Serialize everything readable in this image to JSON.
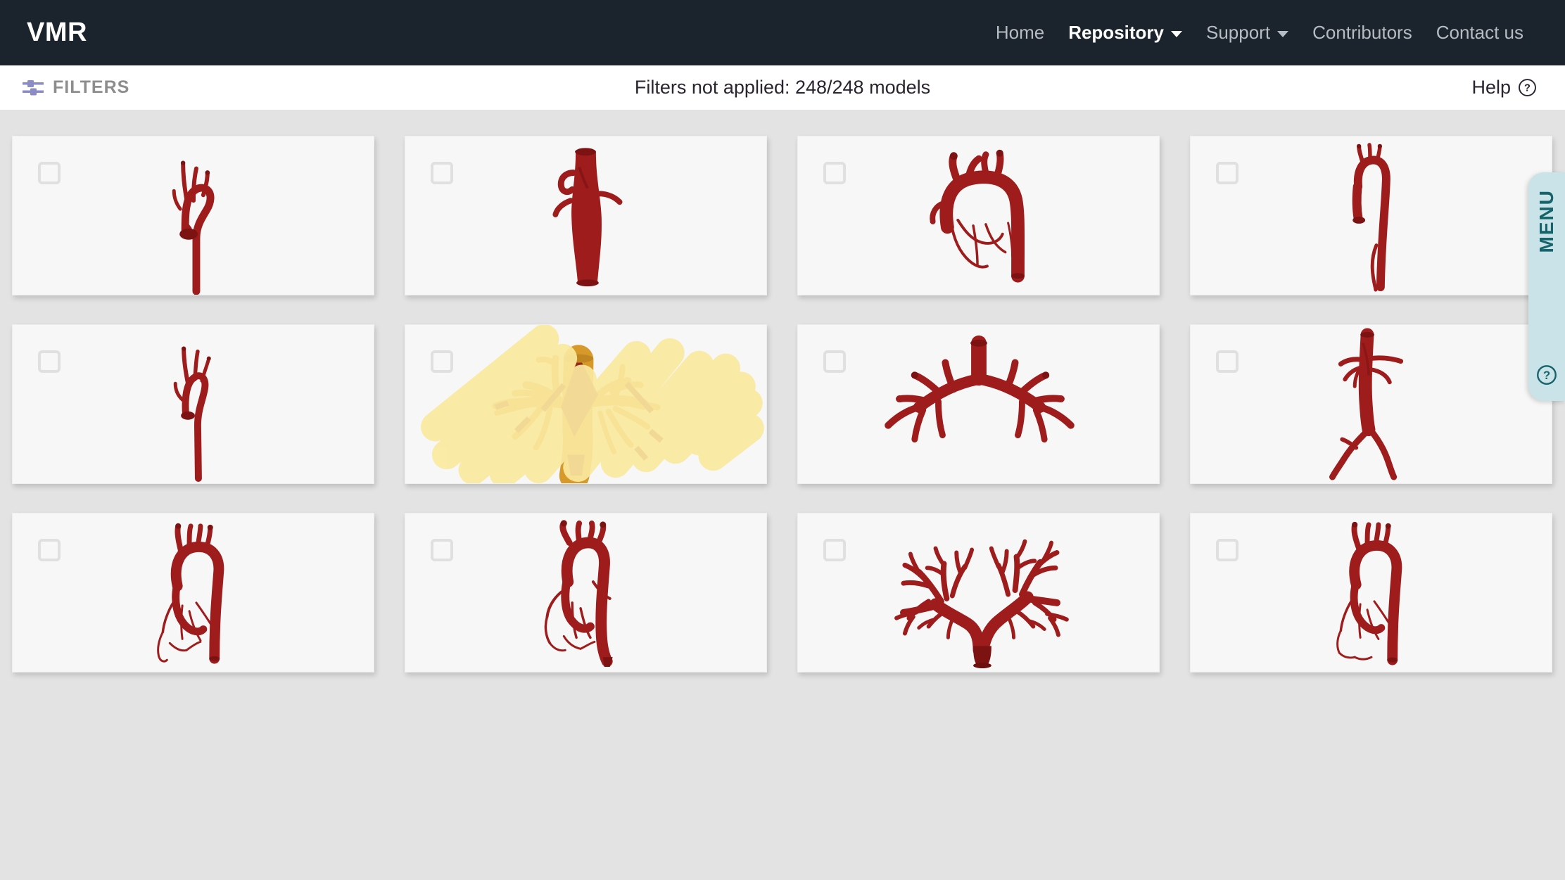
{
  "navbar": {
    "brand": "VMR",
    "links": [
      {
        "label": "Home",
        "active": false,
        "has_caret": false
      },
      {
        "label": "Repository",
        "active": true,
        "has_caret": true
      },
      {
        "label": "Support",
        "active": false,
        "has_caret": true
      },
      {
        "label": "Contributors",
        "active": false,
        "has_caret": false
      },
      {
        "label": "Contact us",
        "active": false,
        "has_caret": false
      }
    ]
  },
  "filterbar": {
    "filters_label": "FILTERS",
    "filters_icon": "sliders-icon",
    "status_text": "Filters not applied: 248/248 models",
    "models_shown": 248,
    "models_total": 248,
    "help_label": "Help",
    "help_icon": "question-circle-icon"
  },
  "menu_tab": {
    "label": "MENU",
    "help_icon": "question-circle-icon",
    "color": "#c9e3e8",
    "text_color": "#16646b"
  },
  "colors": {
    "navbar_bg": "#1b242c",
    "page_bg": "#e3e3e3",
    "card_bg": "#f7f7f7",
    "model_red": "#9e1c1c",
    "model_red_dark": "#7d1212",
    "highlighter_yellow": "#fae9a0",
    "highlight_model_orange": "#d6992a",
    "filters_icon_purple": "#8b8bc5",
    "checkbox_border": "#e0e0e0"
  },
  "grid": {
    "columns": 4,
    "rows": 3,
    "checkbox_icon": "checkbox-unchecked-icon",
    "cards": [
      {
        "index": 1,
        "model": "aortic-arch-descending",
        "checked": false,
        "annotated": false
      },
      {
        "index": 2,
        "model": "abdominal-aorta-segment",
        "checked": false,
        "annotated": false
      },
      {
        "index": 3,
        "model": "aortic-arch-coronaries",
        "checked": false,
        "annotated": false
      },
      {
        "index": 4,
        "model": "aorta-full-arch-descending",
        "checked": false,
        "annotated": false
      },
      {
        "index": 5,
        "model": "aortic-arch-slim",
        "checked": false,
        "annotated": false
      },
      {
        "index": 6,
        "model": "pulmonary-artery-tree",
        "checked": false,
        "annotated": true
      },
      {
        "index": 7,
        "model": "pulmonary-bifurcation",
        "checked": false,
        "annotated": false
      },
      {
        "index": 8,
        "model": "abdominal-aorta-iliac",
        "checked": false,
        "annotated": false
      },
      {
        "index": 9,
        "model": "aorta-with-coronaries",
        "checked": false,
        "annotated": false
      },
      {
        "index": 10,
        "model": "aortic-arch-coronary-tree",
        "checked": false,
        "annotated": false
      },
      {
        "index": 11,
        "model": "pulmonary-artery-tree-full",
        "checked": false,
        "annotated": false
      },
      {
        "index": 12,
        "model": "aorta-coronary-detail",
        "checked": false,
        "annotated": false
      }
    ]
  }
}
